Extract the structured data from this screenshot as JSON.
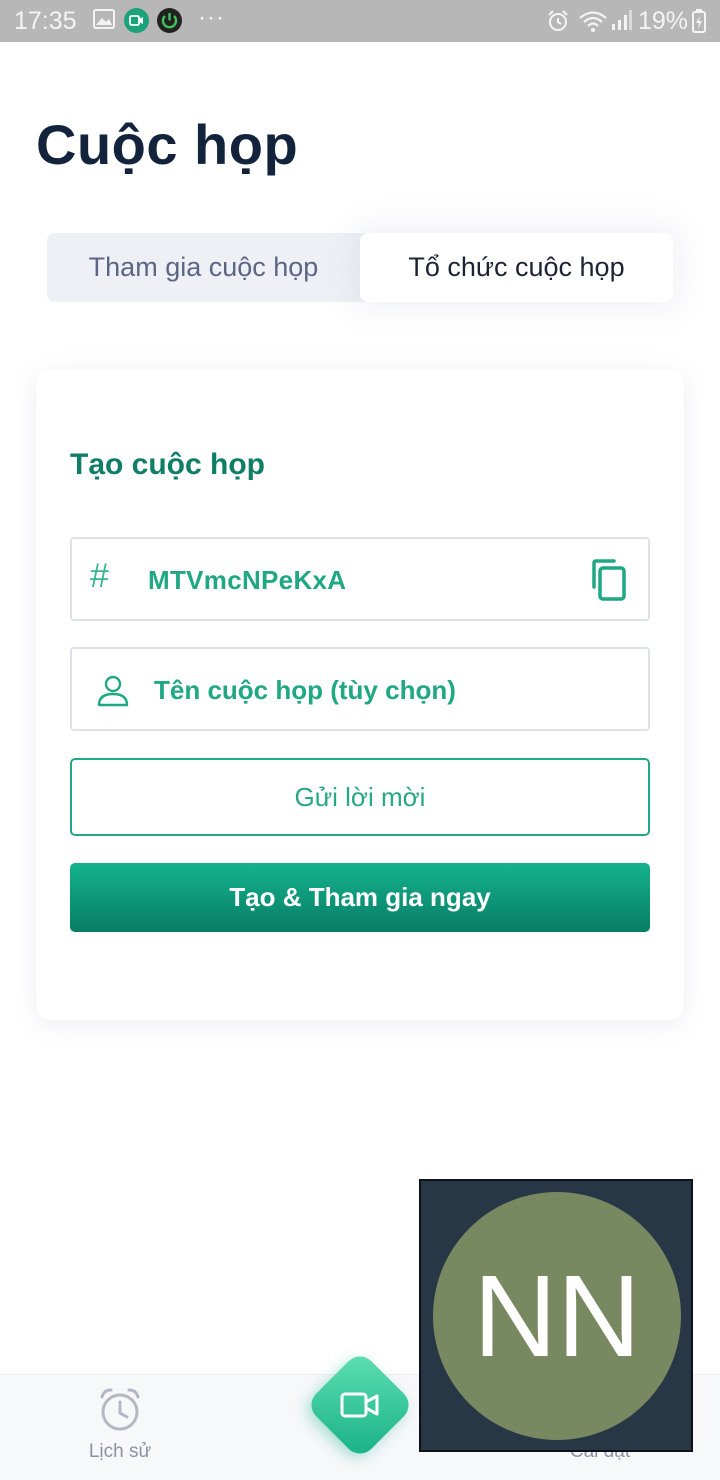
{
  "status_bar": {
    "time": "17:35",
    "battery": "19%",
    "more_indicator": "···",
    "icons": [
      "gallery-icon",
      "screen-record-icon",
      "power-icon",
      "alarm-icon",
      "wifi-icon",
      "signal-icon",
      "battery-icon"
    ]
  },
  "page": {
    "title": "Cuộc họp"
  },
  "tabs": {
    "join": "Tham gia cuộc họp",
    "host": "Tổ chức cuộc họp",
    "active": "host"
  },
  "card": {
    "title": "Tạo cuộc họp",
    "code_prefix": "#",
    "meeting_code": "MTVmcNPeKxA",
    "name_placeholder": "Tên cuộc họp (tùy chọn)",
    "invite_label": "Gửi lời mời",
    "create_label": "Tạo & Tham gia ngay"
  },
  "bottom_nav": {
    "history_label": "Lịch sử",
    "settings_label": "Cài đặt"
  },
  "overlay": {
    "initials": "NN"
  },
  "colors": {
    "accent": "#1fa883",
    "accent_dark": "#0f7e67",
    "title": "#14233c",
    "avatar_bg": "#788860",
    "overlay_bg": "#283746"
  }
}
